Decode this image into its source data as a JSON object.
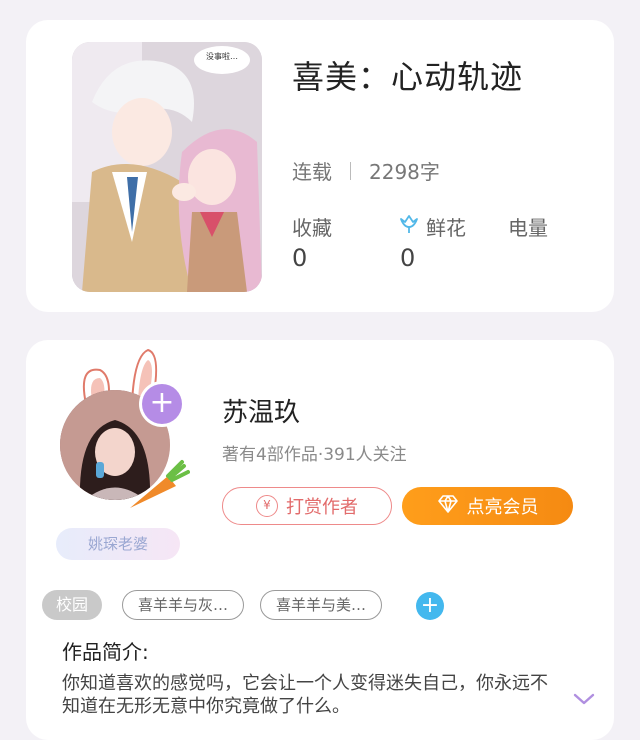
{
  "book": {
    "title": "喜美：心动轨迹",
    "status": "连载",
    "word_count": "2298字",
    "cover_speech": "没事啦…"
  },
  "stats": [
    {
      "label": "收藏",
      "value": "0"
    },
    {
      "label": "鲜花",
      "value": "0",
      "icon": "flower-icon"
    },
    {
      "label": "电量",
      "value": ""
    }
  ],
  "author": {
    "name": "苏温玖",
    "meta": "著有4部作品·391人关注",
    "badge": "姚琛老婆",
    "tip_button": "打赏作者",
    "vip_button": "点亮会员",
    "tip_icon": "¥"
  },
  "tags": [
    "校园",
    "喜羊羊与灰…",
    "喜羊羊与美…"
  ],
  "intro": {
    "label": "作品简介:",
    "text": "你知道喜欢的感觉吗，它会让一个人变得迷失自己，你永远不知道在无形无意中你究竟做了什么。"
  },
  "colors": {
    "background": "#f3f1f6",
    "accent_orange": "#f58a12",
    "accent_pink": "#ee8a8a",
    "accent_purple": "#b58ce6",
    "accent_blue": "#43b8ee"
  }
}
